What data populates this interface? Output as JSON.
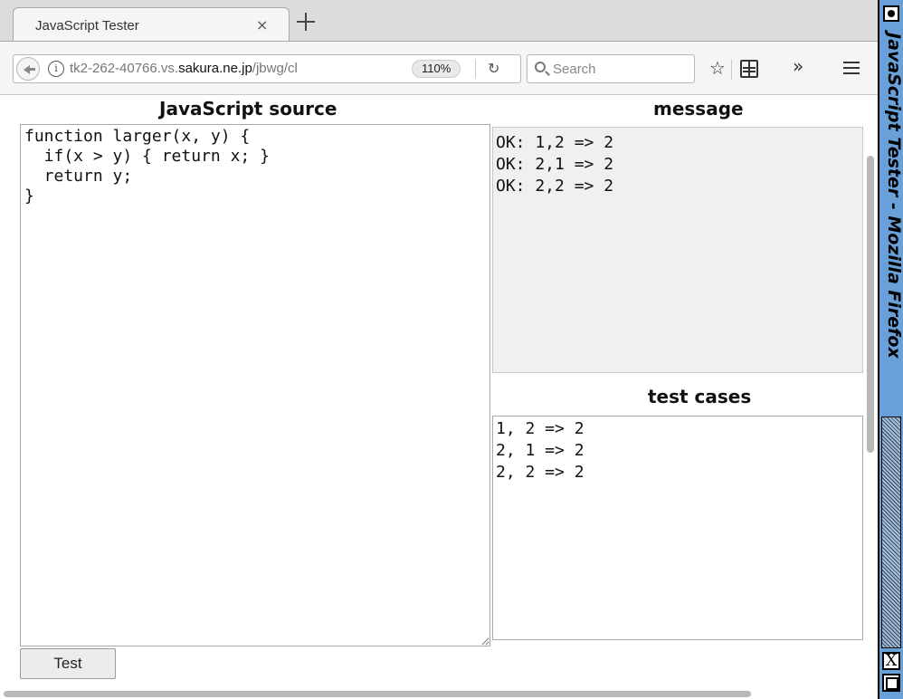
{
  "tab": {
    "title": "JavaScript Tester",
    "close_glyph": "×"
  },
  "navbar": {
    "url_prefix": "tk2-262-40766.vs.",
    "url_domain": "sakura.ne.jp",
    "url_path": "/jbwg/cl",
    "zoom": "110%",
    "search_placeholder": "Search",
    "icons": [
      "back-icon",
      "info-icon",
      "reload-icon",
      "search-icon",
      "bookmark-star-icon",
      "reading-list-icon",
      "overflow-icon",
      "hamburger-menu-icon"
    ]
  },
  "page": {
    "source_heading": "JavaScript source",
    "source_code": "function larger(x, y) {\n  if(x > y) { return x; }\n  return y;\n}",
    "message_heading": "message",
    "messages": [
      "OK: 1,2 => 2",
      "OK: 2,1 => 2",
      "OK: 2,2 => 2"
    ],
    "tests_heading": "test cases",
    "test_cases": "1, 2 => 2\n2, 1 => 2\n2, 2 => 2",
    "test_button": "Test"
  },
  "window": {
    "title": "JavaScript Tester - Mozilla Firefox",
    "close_glyph": "X",
    "strip_color": "#6aa0d8"
  }
}
